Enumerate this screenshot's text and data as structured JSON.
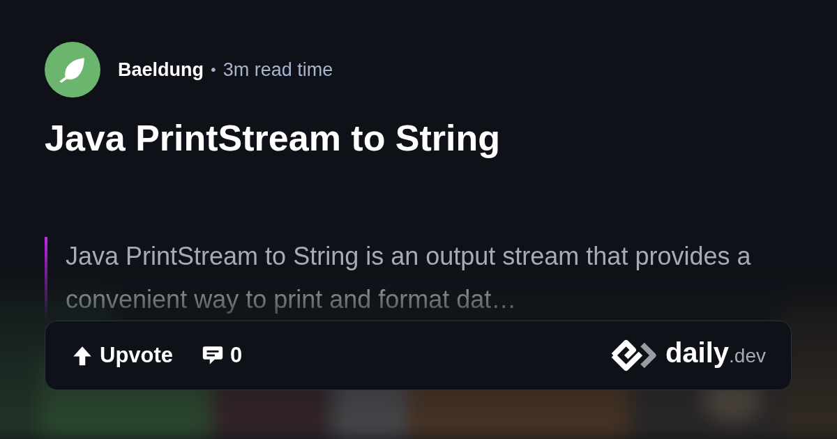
{
  "source": {
    "name": "Baeldung",
    "separator": "•",
    "read_time": "3m read time"
  },
  "title": "Java PrintStream to String",
  "excerpt": "Java PrintStream to String is an output stream that provides a convenient way to print and format dat…",
  "actions": [
    {
      "kind": "upvote",
      "label": "Upvote"
    },
    {
      "kind": "comments",
      "label": "0"
    }
  ],
  "brand": {
    "name": "daily",
    "suffix": ".dev"
  }
}
